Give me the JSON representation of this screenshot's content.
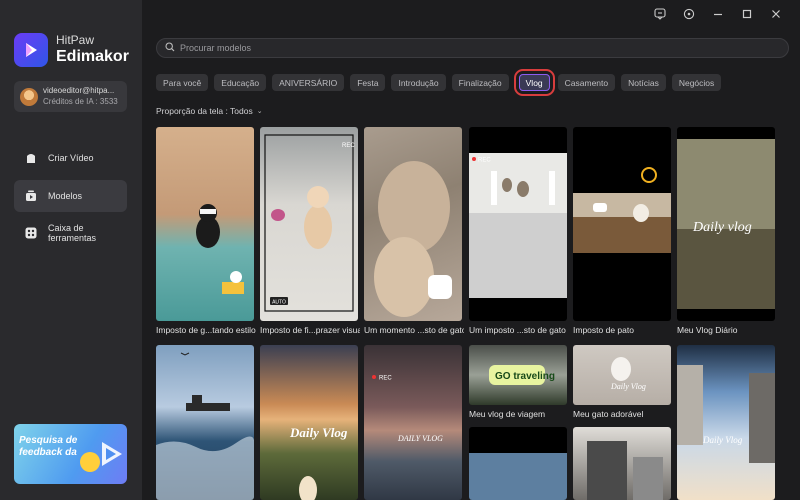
{
  "app": {
    "brand_line1": "HitPaw",
    "brand_line2": "Edimakor",
    "account_email": "videoeditor@hitpa...",
    "account_credits": "Créditos de IA : 3533"
  },
  "sidebar": {
    "items": [
      {
        "label": "Criar Vídeo",
        "icon": "video-create-icon",
        "active": false
      },
      {
        "label": "Modelos",
        "icon": "templates-icon",
        "active": true
      },
      {
        "label": "Caixa de ferramentas",
        "icon": "toolbox-icon",
        "active": false
      }
    ],
    "promo_text": "Pesquisa de feedback da"
  },
  "titlebar": {
    "icons": [
      "feedback-icon",
      "settings-icon",
      "minimize-icon",
      "maximize-icon",
      "close-icon"
    ]
  },
  "search": {
    "placeholder": "Procurar modelos"
  },
  "tabs": [
    "Para você",
    "Educação",
    "ANIVERSÁRIO",
    "Festa",
    "Introdução",
    "Finalização",
    "Vlog",
    "Casamento",
    "Notícias",
    "Negócios"
  ],
  "selected_tab": "Vlog",
  "ratio_filter": "Proporção da tela : Todos",
  "templates": [
    {
      "title": "Imposto de g...tando estilo"
    },
    {
      "title": "Imposto de fi...prazer visual"
    },
    {
      "title": "Um momento ...sto de gato"
    },
    {
      "title": "Um imposto ...sto de gato"
    },
    {
      "title": "Imposto de pato"
    },
    {
      "title": "Meu Vlog Diário"
    },
    {
      "title": ""
    },
    {
      "title": ""
    },
    {
      "title": ""
    },
    {
      "title": "Meu vlog de viagem"
    },
    {
      "title": "Meu gato adorável"
    },
    {
      "title": ""
    }
  ],
  "overlays": {
    "rec": "REC",
    "auto": "AUTO",
    "daily_vlog": "Daily vlog",
    "daily_vlog_2": "Daily Vlog",
    "daily_vlog_caps": "DAILY VLOG",
    "go_traveling": "GO traveling"
  },
  "colors": {
    "accent_purple": "#8c5cf0",
    "highlight_red": "#d83d3d"
  }
}
